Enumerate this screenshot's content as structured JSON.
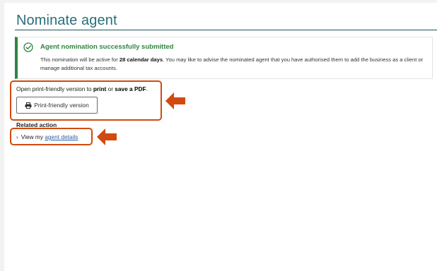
{
  "page": {
    "title": "Nominate agent"
  },
  "alert": {
    "title": "Agent nomination successfully submitted",
    "body_pre": "This nomination will be active for ",
    "body_bold1": "28 calendar days",
    "body_mid": ". You may like to advise the nominated agent that you have authorised them to add the business as a client or manage additional tax accounts.",
    "icon": "check-circle-icon",
    "color": "#2e8540"
  },
  "print": {
    "text_pre": "Open print-friendly version to ",
    "text_bold1": "print",
    "text_mid": " or ",
    "text_bold2": "save a PDF",
    "text_post": ".",
    "button_label": "Print-friendly version",
    "button_icon": "printer-icon"
  },
  "related": {
    "heading": "Related action",
    "link_prefix": "View my ",
    "link_text": "agent details"
  },
  "annotations": {
    "highlight_color": "#d14a0f",
    "arrow_icon": "left-arrow-icon"
  }
}
